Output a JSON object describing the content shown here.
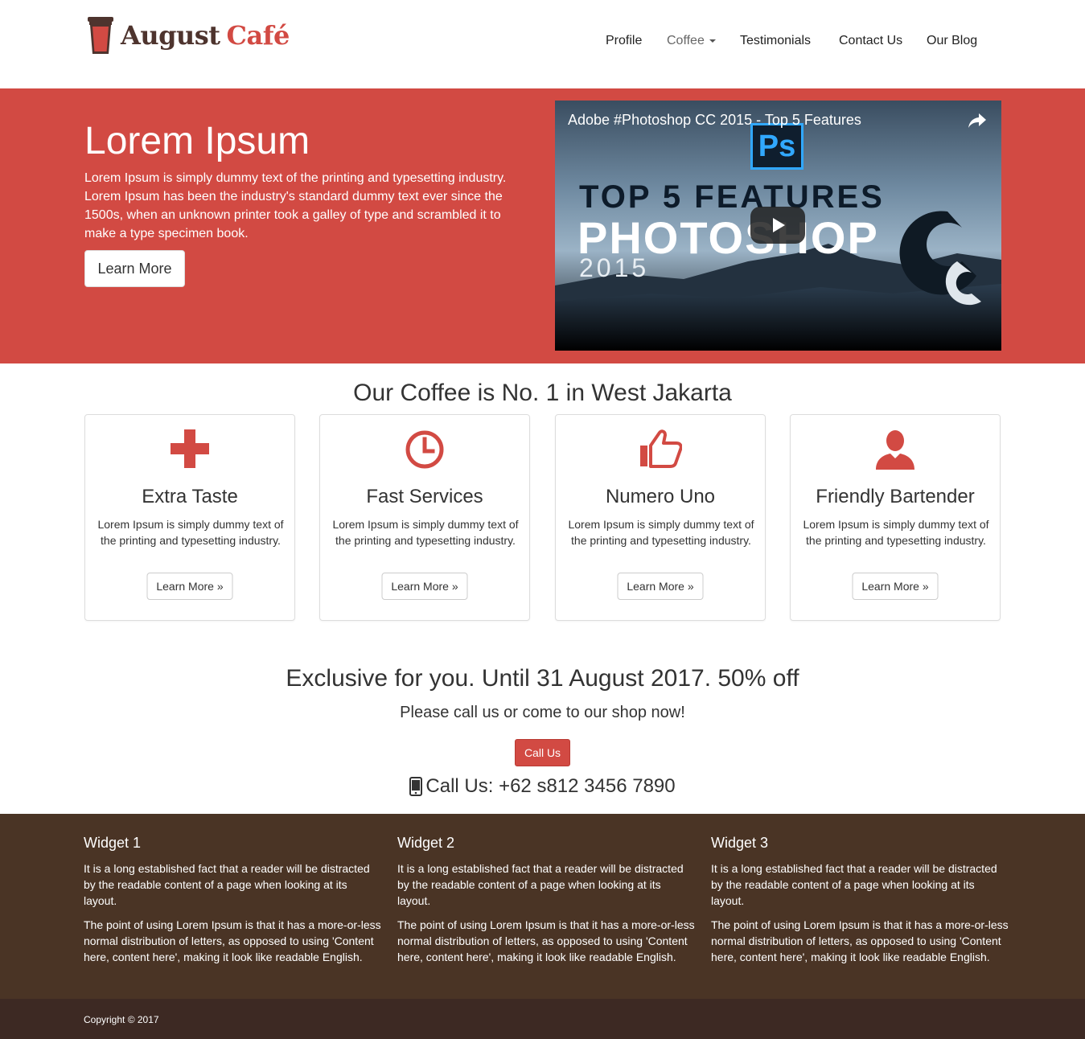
{
  "brand": {
    "name": "August",
    "accent": "Café",
    "accent_color": "#d24a43",
    "text_color": "#4e342e",
    "logo_icon": "coffee-cup-icon"
  },
  "nav": {
    "items": [
      {
        "label": "Profile"
      },
      {
        "label": "Coffee",
        "dropdown": true
      },
      {
        "label": "Testimonials"
      },
      {
        "label": "Contact Us"
      },
      {
        "label": "Our Blog"
      }
    ]
  },
  "hero": {
    "background_color": "#d24a43",
    "title": "Lorem Ipsum",
    "text": "Lorem Ipsum is simply dummy text of the printing and typesetting industry. Lorem Ipsum has been the industry's standard dummy text ever since the 1500s, when an unknown printer took a galley of type and scrambled it to make a type specimen book.",
    "button_label": "Learn More",
    "video": {
      "title": "Adobe #Photoshop CC 2015 - Top 5 Features",
      "thumbnail_badge": "Ps",
      "thumbnail_line1": "TOP 5 FEATURES",
      "thumbnail_line2": "PHOTOSHOP",
      "thumbnail_line3": "2015",
      "share_icon": "share-icon",
      "play_icon": "play-icon"
    }
  },
  "features": {
    "title": "Our Coffee is No. 1 in West Jakarta",
    "icon_color": "#d24a43",
    "cards": [
      {
        "icon": "plus-icon",
        "title": "Extra Taste",
        "text": "Lorem Ipsum is simply dummy text of the printing and typesetting industry.",
        "button": "Learn More »"
      },
      {
        "icon": "clock-icon",
        "title": "Fast Services",
        "text": "Lorem Ipsum is simply dummy text of the printing and typesetting industry.",
        "button": "Learn More »"
      },
      {
        "icon": "thumbs-up-icon",
        "title": "Numero Uno",
        "text": "Lorem Ipsum is simply dummy text of the printing and typesetting industry.",
        "button": "Learn More »"
      },
      {
        "icon": "user-icon",
        "title": "Friendly Bartender",
        "text": "Lorem Ipsum is simply dummy text of the printing and typesetting industry.",
        "button": "Learn More »"
      }
    ]
  },
  "promo": {
    "title": "Exclusive for you. Until 31 August 2017. 50% off",
    "subtitle": "Please call us or come to our shop now!",
    "button_label": "Call Us",
    "phone_text": "Call Us: +62 s812 3456 7890",
    "phone_icon": "mobile-phone-icon"
  },
  "widgets": {
    "background_color": "#4a3425",
    "items": [
      {
        "title": "Widget 1",
        "p1": "It is a long established fact that a reader will be distracted by the readable content of a page when looking at its layout.",
        "p2": "The point of using Lorem Ipsum is that it has a more-or-less normal distribution of letters, as opposed to using 'Content here, content here', making it look like readable English."
      },
      {
        "title": "Widget 2",
        "p1": "It is a long established fact that a reader will be distracted by the readable content of a page when looking at its layout.",
        "p2": "The point of using Lorem Ipsum is that it has a more-or-less normal distribution of letters, as opposed to using 'Content here, content here', making it look like readable English."
      },
      {
        "title": "Widget 3",
        "p1": "It is a long established fact that a reader will be distracted by the readable content of a page when looking at its layout.",
        "p2": "The point of using Lorem Ipsum is that it has a more-or-less normal distribution of letters, as opposed to using 'Content here, content here', making it look like readable English."
      }
    ]
  },
  "footer": {
    "copyright": "Copyright © 2017",
    "background_color": "#3d2923"
  }
}
